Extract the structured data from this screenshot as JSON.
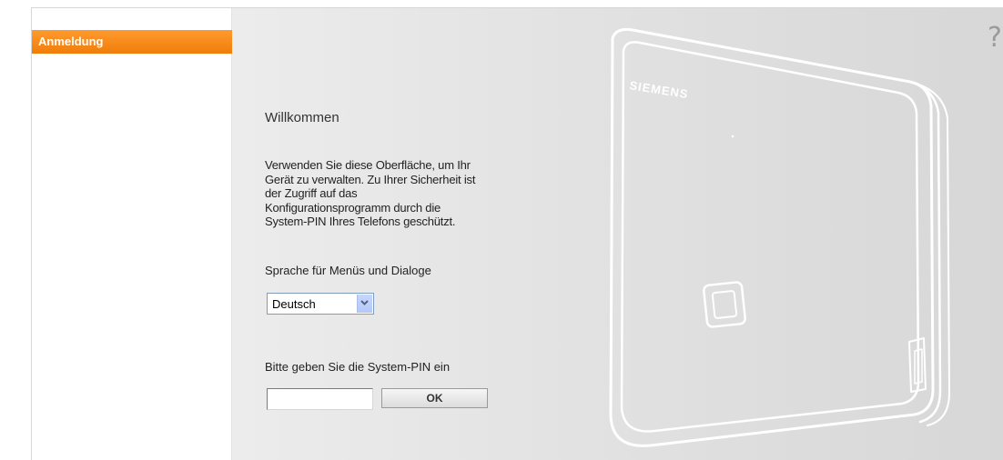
{
  "sidebar": {
    "items": [
      {
        "label": "Anmeldung",
        "active": true
      }
    ],
    "active_color": "#f5840f"
  },
  "help": {
    "icon": "question-mark-icon",
    "label": "?"
  },
  "device": {
    "brand": "SIEMENS"
  },
  "main": {
    "title": "Willkommen",
    "intro_lines": [
      "Verwenden Sie diese Oberfläche, um Ihr",
      "Gerät zu verwalten. Zu Ihrer Sicherheit ist",
      "der Zugriff auf das",
      "Konfigurationsprogramm durch die",
      "System-PIN Ihres Telefons geschützt."
    ],
    "language_label": "Sprache für Menüs und Dialoge",
    "language_selected": "Deutsch",
    "pin_label": "Bitte geben Sie die System-PIN ein",
    "pin_value": "",
    "ok_label": "OK"
  }
}
